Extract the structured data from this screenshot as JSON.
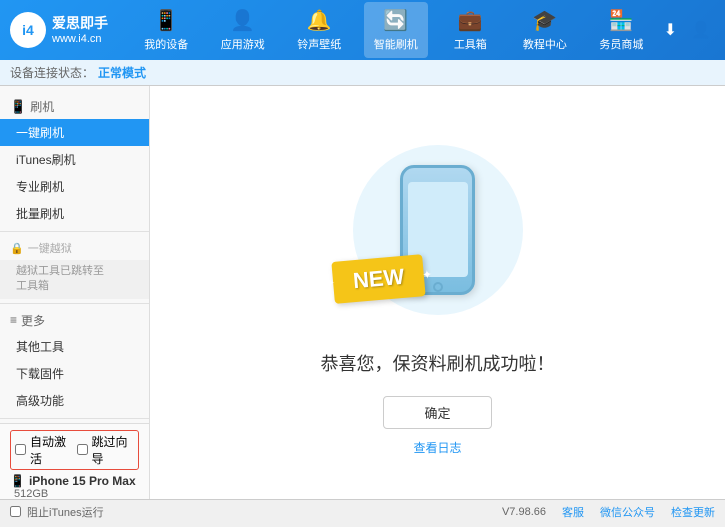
{
  "app": {
    "logo_icon": "i4",
    "logo_brand": "爱思即手",
    "logo_url": "www.i4.cn"
  },
  "nav": {
    "items": [
      {
        "id": "my-device",
        "icon": "📱",
        "label": "我的设备"
      },
      {
        "id": "apps-games",
        "icon": "👤",
        "label": "应用游戏"
      },
      {
        "id": "ringtones",
        "icon": "🔔",
        "label": "铃声壁纸"
      },
      {
        "id": "smart-flash",
        "icon": "🔄",
        "label": "智能刷机",
        "active": true
      },
      {
        "id": "toolbox",
        "icon": "💼",
        "label": "工具箱"
      },
      {
        "id": "tutorial",
        "icon": "🎓",
        "label": "教程中心"
      },
      {
        "id": "business",
        "icon": "🏪",
        "label": "务员商城"
      }
    ]
  },
  "status_bar": {
    "prefix": "设备连接状态：",
    "value": "正常模式"
  },
  "sidebar": {
    "flash_section": {
      "icon": "📱",
      "label": "刷机"
    },
    "items": [
      {
        "id": "one-click-flash",
        "label": "一键刷机",
        "active": true
      },
      {
        "id": "itunes-flash",
        "label": "iTunes刷机"
      },
      {
        "id": "pro-flash",
        "label": "专业刷机"
      },
      {
        "id": "batch-flash",
        "label": "批量刷机"
      }
    ],
    "disabled_section": {
      "icon": "🔒",
      "label": "一键越狱"
    },
    "disabled_note": "越狱工具已跳转至\n工具箱",
    "more_section": {
      "label": "更多"
    },
    "more_items": [
      {
        "id": "other-tools",
        "label": "其他工具"
      },
      {
        "id": "download-firmware",
        "label": "下载固件"
      },
      {
        "id": "advanced",
        "label": "高级功能"
      }
    ]
  },
  "device_panel": {
    "auto_activate_label": "自动激活",
    "skip_guide_label": "跳过向导",
    "device_icon": "📱",
    "device_name": "iPhone 15 Pro Max",
    "device_storage": "512GB",
    "device_type": "iPhone"
  },
  "content": {
    "success_message": "恭喜您，保资料刷机成功啦！",
    "confirm_button": "确定",
    "log_link": "查看日志"
  },
  "footer": {
    "stop_itunes": "阻止iTunes运行",
    "version": "V7.98.66",
    "links": [
      "客服",
      "微信公众号",
      "检查更新"
    ]
  }
}
